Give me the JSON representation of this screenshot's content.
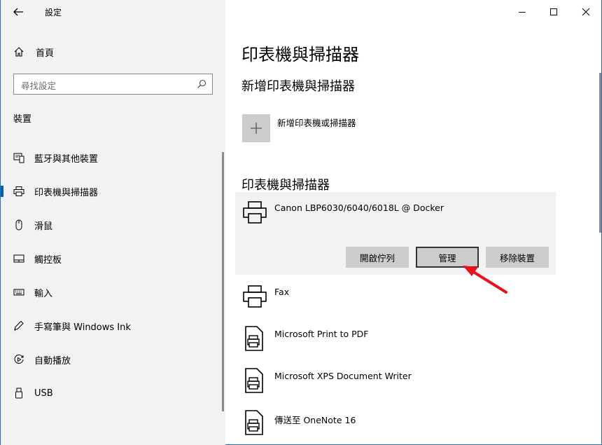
{
  "window": {
    "title": "設定"
  },
  "sidebar": {
    "home_label": "首頁",
    "search_placeholder": "尋找設定",
    "section_label": "裝置",
    "items": [
      {
        "label": "藍牙與其他裝置",
        "icon": "bluetooth-devices-icon"
      },
      {
        "label": "印表機與掃描器",
        "icon": "printer-icon"
      },
      {
        "label": "滑鼠",
        "icon": "mouse-icon"
      },
      {
        "label": "觸控板",
        "icon": "touchpad-icon"
      },
      {
        "label": "輸入",
        "icon": "keyboard-icon"
      },
      {
        "label": "手寫筆與 Windows Ink",
        "icon": "pen-icon"
      },
      {
        "label": "自動播放",
        "icon": "autoplay-icon"
      },
      {
        "label": "USB",
        "icon": "usb-icon"
      }
    ],
    "active_index": 1
  },
  "main": {
    "page_title": "印表機與掃描器",
    "add_section_title": "新增印表機與掃描器",
    "add_label": "新增印表機或掃描器",
    "list_section_title": "印表機與掃描器",
    "selected_printer": {
      "name": "Canon LBP6030/6040/6018L @ Docker",
      "buttons": {
        "open_queue": "開啟佇列",
        "manage": "管理",
        "remove": "移除裝置"
      }
    },
    "printers": [
      {
        "name": "Fax",
        "icon": "fax-printer-icon"
      },
      {
        "name": "Microsoft Print to PDF",
        "icon": "document-printer-icon"
      },
      {
        "name": "Microsoft XPS Document Writer",
        "icon": "document-printer-icon"
      },
      {
        "name": "傳送至 OneNote 16",
        "icon": "document-printer-icon"
      }
    ]
  },
  "colors": {
    "sidebar_bg": "#f2f2f2",
    "accent": "#0063b1",
    "annotation_arrow": "#e8141c"
  }
}
